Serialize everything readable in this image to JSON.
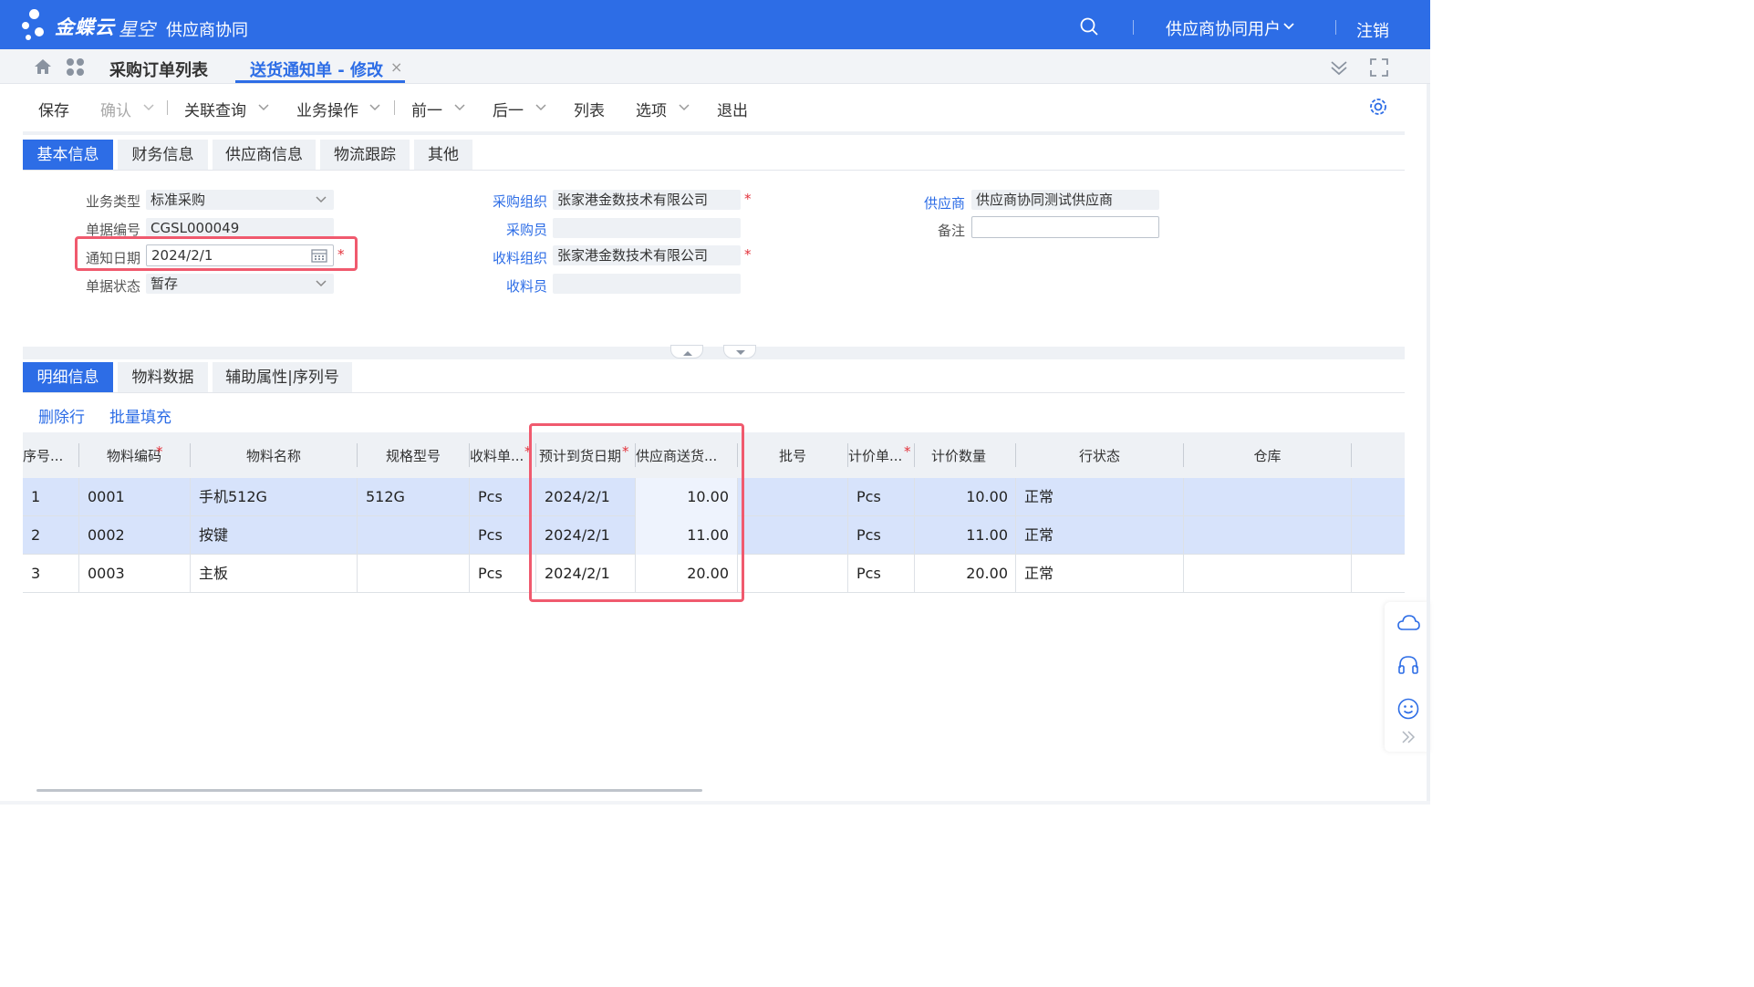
{
  "header": {
    "brand": "金蝶云",
    "product": "星空",
    "app_name": "供应商协同",
    "user": "供应商协同用户",
    "logout": "注销"
  },
  "tabs": {
    "list_tab": "采购订单列表",
    "active_tab": "送货通知单 - 修改",
    "close_glyph": "×"
  },
  "toolbar": {
    "save": "保存",
    "confirm": "确认",
    "related_query": "关联查询",
    "business_ops": "业务操作",
    "prev": "前一",
    "next": "后一",
    "list": "列表",
    "options": "选项",
    "exit": "退出"
  },
  "section_tabs": [
    "基本信息",
    "财务信息",
    "供应商信息",
    "物流跟踪",
    "其他"
  ],
  "form": {
    "business_type_label": "业务类型",
    "business_type_value": "标准采购",
    "doc_no_label": "单据编号",
    "doc_no_value": "CGSL000049",
    "notice_date_label": "通知日期",
    "notice_date_value": "2024/2/1",
    "doc_status_label": "单据状态",
    "doc_status_value": "暂存",
    "purchase_org_label": "采购组织",
    "purchase_org_value": "张家港金数技术有限公司",
    "buyer_label": "采购员",
    "buyer_value": "",
    "receive_org_label": "收料组织",
    "receive_org_value": "张家港金数技术有限公司",
    "receiver_label": "收料员",
    "receiver_value": "",
    "supplier_label": "供应商",
    "supplier_value": "供应商协同测试供应商",
    "remark_label": "备注",
    "remark_value": "",
    "required_mark": "*"
  },
  "detail_tabs": [
    "明细信息",
    "物料数据",
    "辅助属性|序列号"
  ],
  "detail_actions": {
    "delete_row": "删除行",
    "batch_fill": "批量填充"
  },
  "grid": {
    "columns": [
      "序号...",
      "物料编码",
      "物料名称",
      "规格型号",
      "收料单...",
      "预计到货日期",
      "供应商送货...",
      "批号",
      "计价单...",
      "计价数量",
      "行状态",
      "仓库"
    ],
    "rows": [
      [
        "1",
        "0001",
        "手机512G",
        "512G",
        "Pcs",
        "2024/2/1",
        "10.00",
        "",
        "Pcs",
        "10.00",
        "正常",
        ""
      ],
      [
        "2",
        "0002",
        "按键",
        "",
        "Pcs",
        "2024/2/1",
        "11.00",
        "",
        "Pcs",
        "11.00",
        "正常",
        ""
      ],
      [
        "3",
        "0003",
        "主板",
        "",
        "Pcs",
        "2024/2/1",
        "20.00",
        "",
        "Pcs",
        "20.00",
        "正常",
        ""
      ]
    ]
  },
  "colors": {
    "primary": "#2d6de6",
    "highlight": "#f05a6e",
    "selected_row": "#d7e3fb"
  }
}
